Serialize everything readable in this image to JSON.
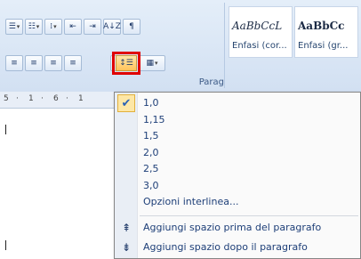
{
  "ribbon": {
    "row1": [
      "☰",
      "☷",
      "⁞",
      "⇤",
      "⇥",
      "A↓Z",
      "¶"
    ],
    "row2": [
      "≡",
      "≡",
      "≡",
      "≡",
      "⌂",
      "▦"
    ],
    "group_label": "Parag"
  },
  "styles": [
    {
      "sample": "AaBbCcL",
      "name": "Enfasi (cor..."
    },
    {
      "sample": "AaBbCc",
      "name": "Enfasi (gr..."
    }
  ],
  "ruler": {
    "marks": [
      "5",
      "·",
      "1",
      "·",
      "6",
      "·",
      "1"
    ]
  },
  "line_spacing_button_icon": "line-spacing-icon",
  "menu": {
    "spacing_options": [
      "1,0",
      "1,15",
      "1,5",
      "2,0",
      "2,5",
      "3,0"
    ],
    "selected": "1,0",
    "options_label": "Opzioni interlinea...",
    "add_before": "Aggiungi spazio prima del paragrafo",
    "add_after": "Aggiungi spazio dopo il paragrafo"
  },
  "colors": {
    "highlight": "#e00000",
    "menu_text": "#1e3f78",
    "check_bg": "#fde7a6"
  }
}
